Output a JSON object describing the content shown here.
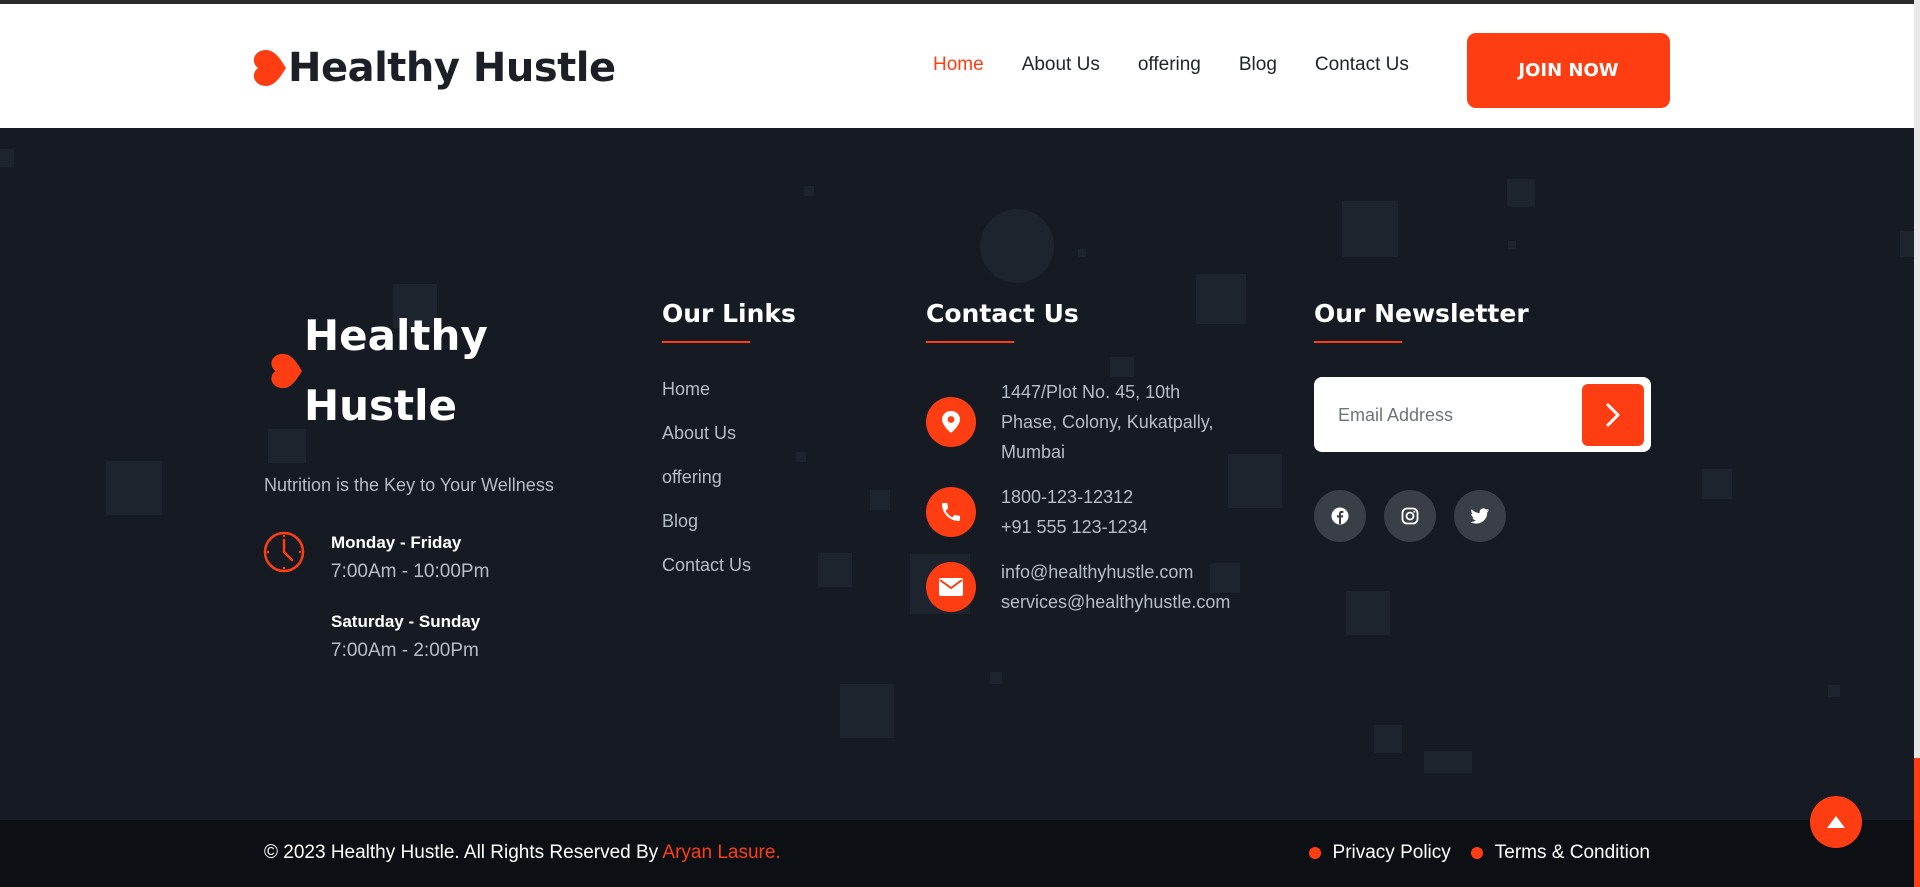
{
  "header": {
    "brand": "Healthy Hustle",
    "nav": [
      {
        "label": "Home",
        "active": true
      },
      {
        "label": "About Us"
      },
      {
        "label": "offering"
      },
      {
        "label": "Blog"
      },
      {
        "label": "Contact Us"
      }
    ],
    "cta_label": "JOIN NOW"
  },
  "footer": {
    "brand_line1": "Healthy",
    "brand_line2": "Hustle",
    "tagline": "Nutrition is the Key to Your Wellness",
    "hours": [
      {
        "day": "Monday - Friday",
        "time": "7:00Am - 10:00Pm"
      },
      {
        "day": "Saturday - Sunday",
        "time": "7:00Am - 2:00Pm"
      }
    ],
    "links_title": "Our Links",
    "links": [
      "Home",
      "About Us",
      "offering",
      "Blog",
      "Contact Us"
    ],
    "contact_title": "Contact Us",
    "address_lines": [
      "1447/Plot No. 45, 10th",
      "Phase, Colony, Kukatpally,",
      "Mumbai"
    ],
    "phones": [
      "1800-123-12312",
      "+91 555 123-1234"
    ],
    "emails": [
      "info@healthyhustle.com",
      "services@healthyhustle.com"
    ],
    "newsletter_title": "Our Newsletter",
    "email_placeholder": "Email Address",
    "social": [
      "facebook-icon",
      "instagram-icon",
      "twitter-icon"
    ]
  },
  "bottom": {
    "copyright": "© 2023 Healthy Hustle. All Rights Reserved By ",
    "author": "Aryan Lasure.",
    "legal": [
      "Privacy Policy",
      "Terms & Condition"
    ]
  },
  "colors": {
    "accent": "#ff3d13",
    "footer_bg": "#161b23",
    "bottom_bg": "#0c1014"
  }
}
